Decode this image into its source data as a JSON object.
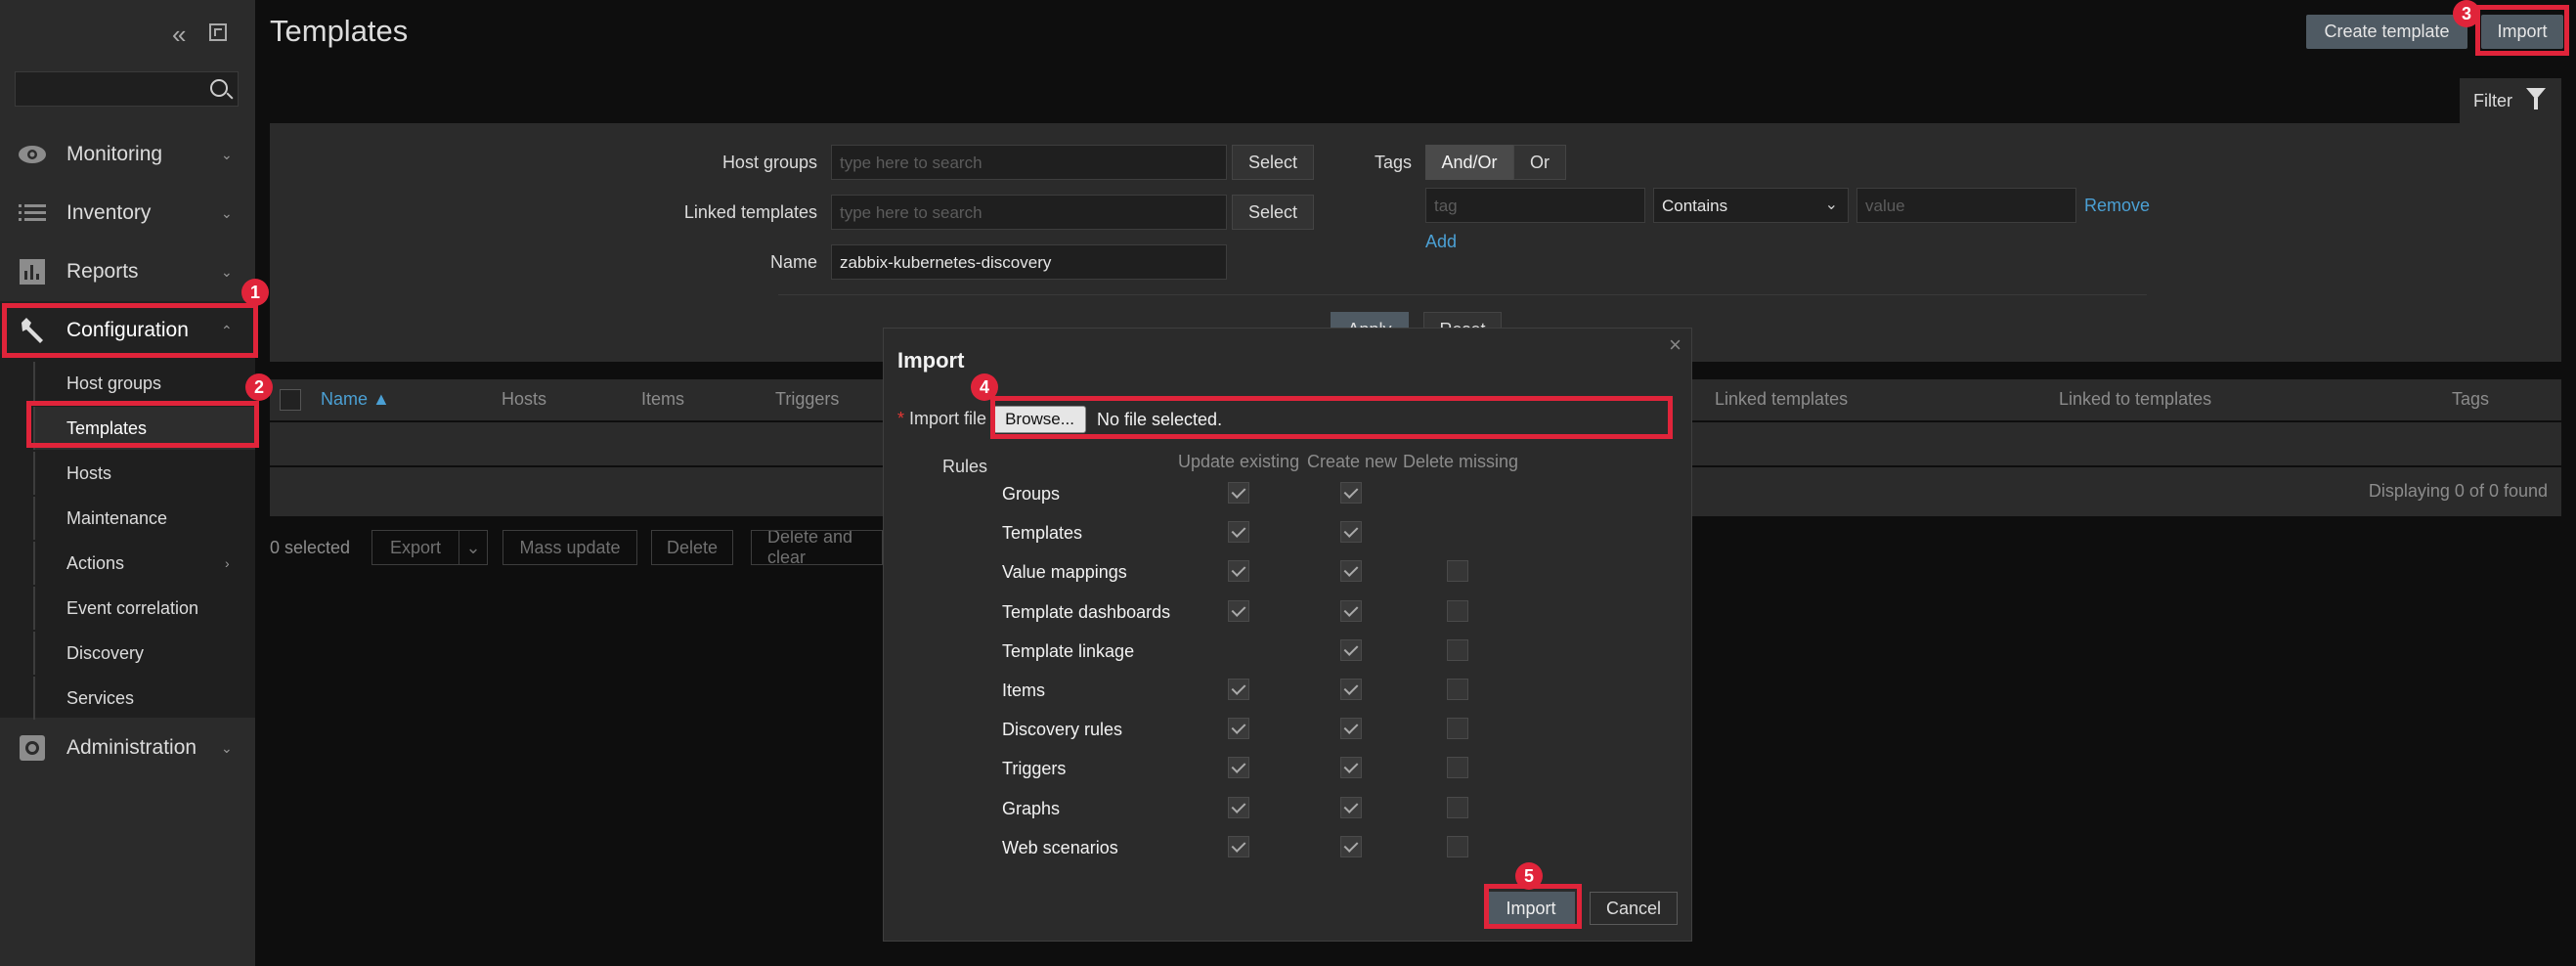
{
  "sidebar": {
    "collapse_icon": "double-chevron-left-icon",
    "kiosk_icon": "kiosk-mode-icon",
    "search": {
      "value": "",
      "placeholder": ""
    },
    "menu": [
      {
        "label": "Monitoring",
        "icon": "eye-icon"
      },
      {
        "label": "Inventory",
        "icon": "list-icon"
      },
      {
        "label": "Reports",
        "icon": "bar-chart-icon"
      },
      {
        "label": "Configuration",
        "icon": "wrench-icon"
      },
      {
        "label": "Administration",
        "icon": "gear-icon"
      }
    ],
    "submenu": [
      "Host groups",
      "Templates",
      "Hosts",
      "Maintenance",
      "Actions",
      "Event correlation",
      "Discovery",
      "Services"
    ]
  },
  "header": {
    "title": "Templates",
    "create_label": "Create template",
    "import_label": "Import"
  },
  "filter": {
    "tab_label": "Filter",
    "host_groups_label": "Host groups",
    "host_groups_placeholder": "type here to search",
    "linked_templates_label": "Linked templates",
    "linked_templates_placeholder": "type here to search",
    "name_label": "Name",
    "name_value": "zabbix-kubernetes-discovery",
    "select_label": "Select",
    "tags_label": "Tags",
    "and_or_label": "And/Or",
    "or_label": "Or",
    "tag_placeholder": "tag",
    "operator_value": "Contains",
    "value_placeholder": "value",
    "remove_label": "Remove",
    "add_label": "Add",
    "apply_label": "Apply",
    "reset_label": "Reset"
  },
  "table": {
    "columns": [
      "Name ▲",
      "Hosts",
      "Items",
      "Triggers",
      "Linked templates",
      "Linked to templates",
      "Tags"
    ],
    "footer": "Displaying 0 of 0 found"
  },
  "bulk": {
    "selected": "0 selected",
    "export": "Export",
    "mass_update": "Mass update",
    "delete": "Delete",
    "delete_clear": "Delete and clear"
  },
  "modal": {
    "title": "Import",
    "import_file_label": "Import file",
    "browse_label": "Browse...",
    "file_status": "No file selected.",
    "rules_label": "Rules",
    "col_update": "Update existing",
    "col_create": "Create new",
    "col_delete": "Delete missing",
    "rules": [
      {
        "name": "Groups",
        "update": true,
        "create": true,
        "delete": null
      },
      {
        "name": "Templates",
        "update": true,
        "create": true,
        "delete": null
      },
      {
        "name": "Value mappings",
        "update": true,
        "create": true,
        "delete": false
      },
      {
        "name": "Template dashboards",
        "update": true,
        "create": true,
        "delete": false
      },
      {
        "name": "Template linkage",
        "update": null,
        "create": true,
        "delete": false
      },
      {
        "name": "Items",
        "update": true,
        "create": true,
        "delete": false
      },
      {
        "name": "Discovery rules",
        "update": true,
        "create": true,
        "delete": false
      },
      {
        "name": "Triggers",
        "update": true,
        "create": true,
        "delete": false
      },
      {
        "name": "Graphs",
        "update": true,
        "create": true,
        "delete": false
      },
      {
        "name": "Web scenarios",
        "update": true,
        "create": true,
        "delete": false
      }
    ],
    "import_btn": "Import",
    "cancel_btn": "Cancel"
  },
  "annotations": [
    "1",
    "2",
    "3",
    "4",
    "5"
  ]
}
